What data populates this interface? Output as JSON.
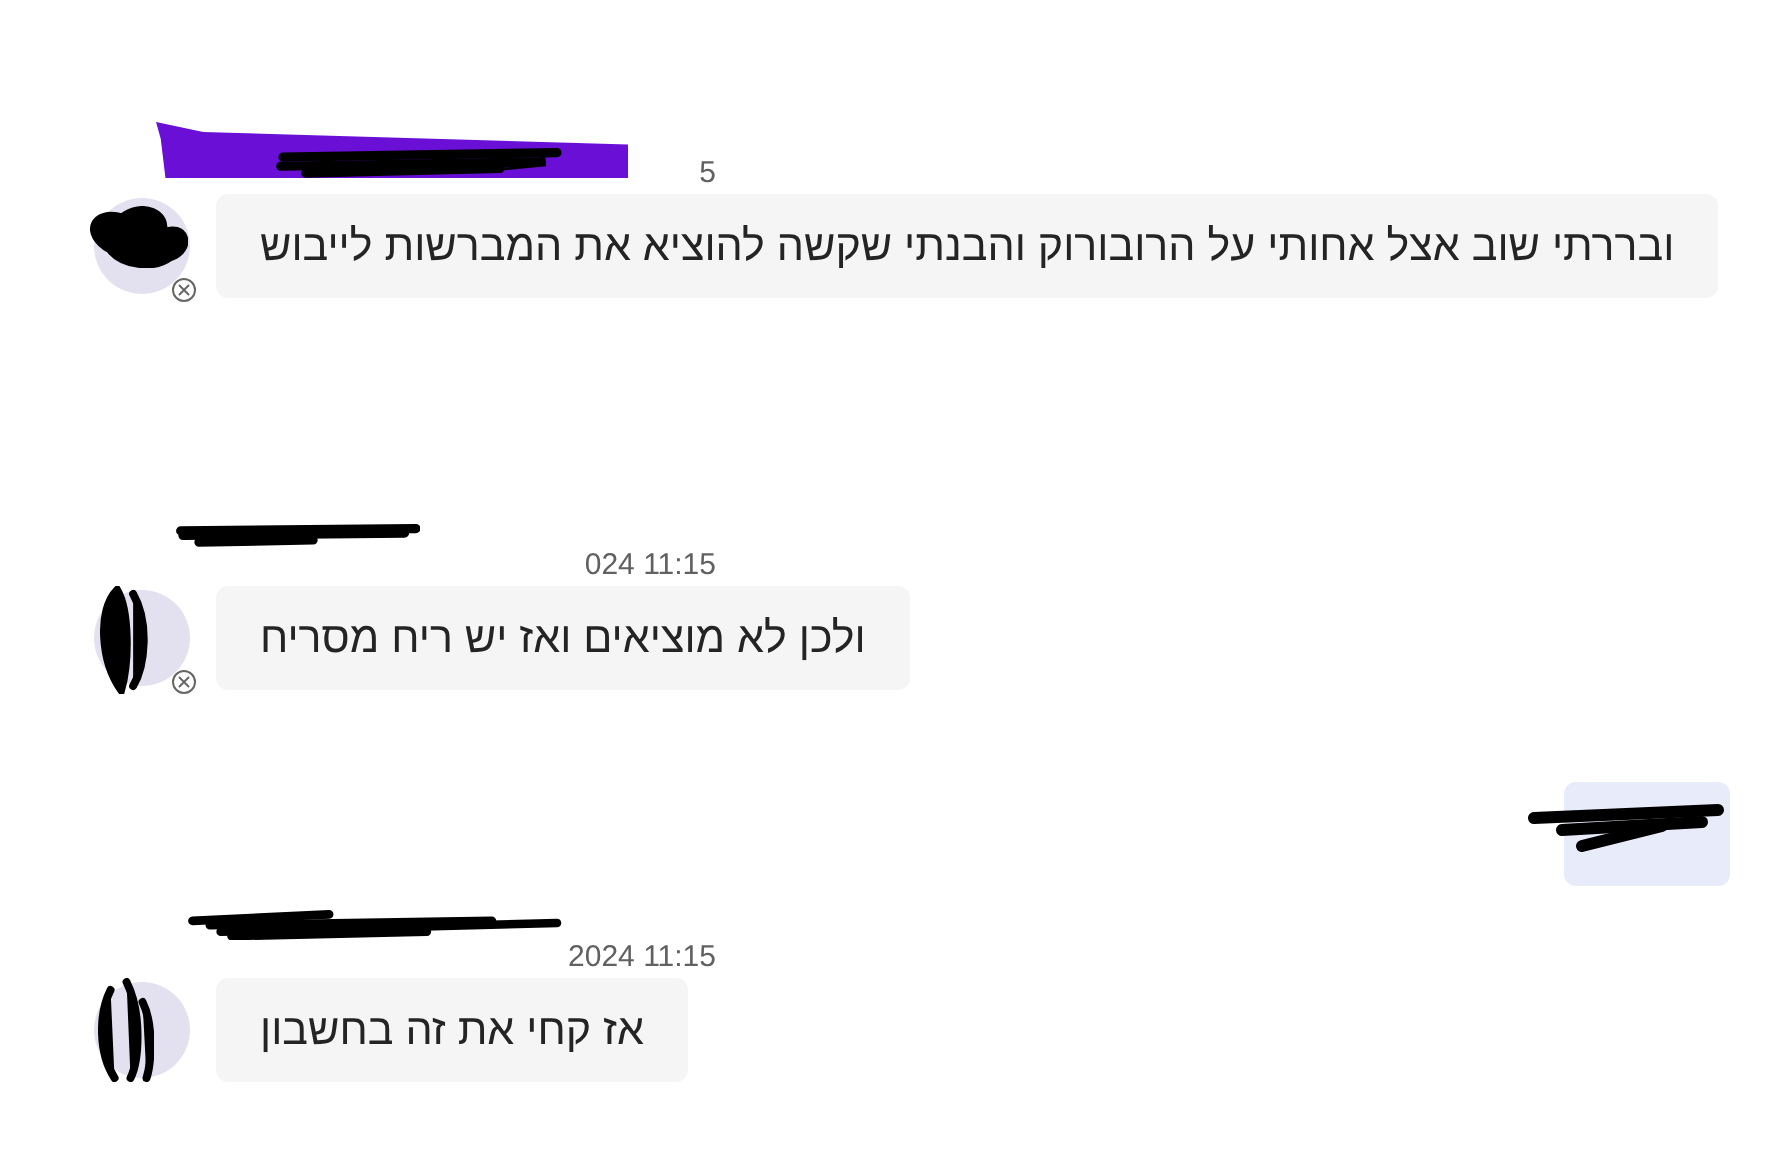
{
  "messages": [
    {
      "kind": "received",
      "author_redacted": true,
      "timestamp": "5",
      "text": "ובררתי שוב אצל אחותי על הרובורוק והבנתי שקשה להוציא את המברשות לייבוש",
      "avatar_redacted": true,
      "status_icon": true
    },
    {
      "kind": "received",
      "author_redacted": true,
      "timestamp": "024 11:15",
      "text": "ולכן לא מוציאים ואז יש ריח מסריח",
      "avatar_redacted": true,
      "status_icon": true
    },
    {
      "kind": "sent",
      "content_redacted": true
    },
    {
      "kind": "received",
      "author_redacted": true,
      "timestamp": "2024 11:15",
      "text": "אז קחי את זה בחשבון",
      "avatar_redacted": true,
      "status_icon": false
    }
  ]
}
